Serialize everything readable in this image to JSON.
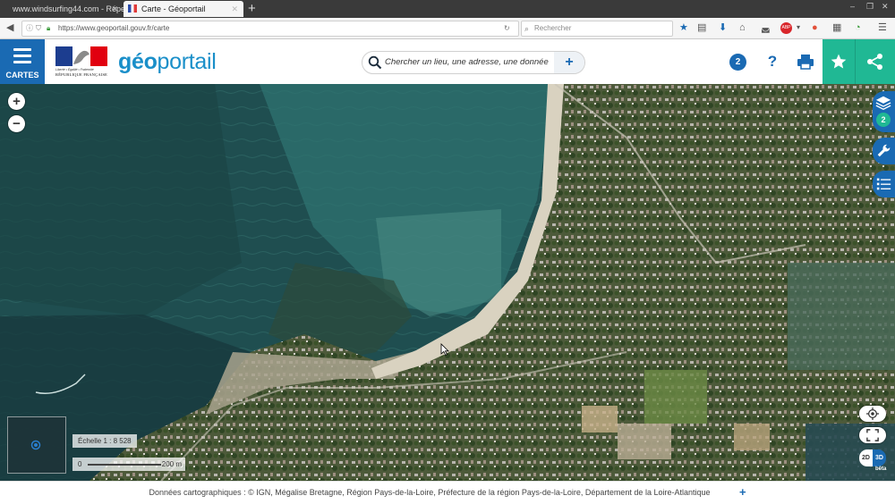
{
  "browser": {
    "tabs": [
      {
        "label": "www.windsurfing44.com - Répe",
        "active": false
      },
      {
        "label": "Carte - Géoportail",
        "active": true
      }
    ],
    "new_tab": "+",
    "url": "https://www.geoportail.gouv.fr/carte",
    "search_placeholder": "Rechercher",
    "addon_badge": "ABP"
  },
  "header": {
    "menu_label": "CARTES",
    "marianne_tagline": "Liberté • Égalité • Fraternité",
    "marianne_republic": "RÉPUBLIQUE FRANÇAISE",
    "logo_geo": "géo",
    "logo_portail": "portail",
    "search_placeholder": "Chercher un lieu, une adresse, une donnée",
    "search_plus": "+",
    "layer_count": "2",
    "help": "?"
  },
  "map": {
    "zoom_in": "+",
    "zoom_out": "−",
    "layers_badge": "2",
    "scale_label": "Échelle 1 : 8 528",
    "scalebar_zero": "0",
    "scalebar_distance": "200 m",
    "mode_2d": "2D",
    "mode_3d": "3D",
    "beta": "bêta"
  },
  "footer": {
    "attribution": "Données cartographiques : © IGN, Mégalise Bretagne, Région Pays-de-la-Loire, Préfecture de la région Pays-de-la-Loire, Département de la Loire-Atlantique",
    "more": "+"
  },
  "colors": {
    "primary_blue": "#1a6ab3",
    "accent_green": "#20b894",
    "logo_blue": "#1a8fc9"
  }
}
